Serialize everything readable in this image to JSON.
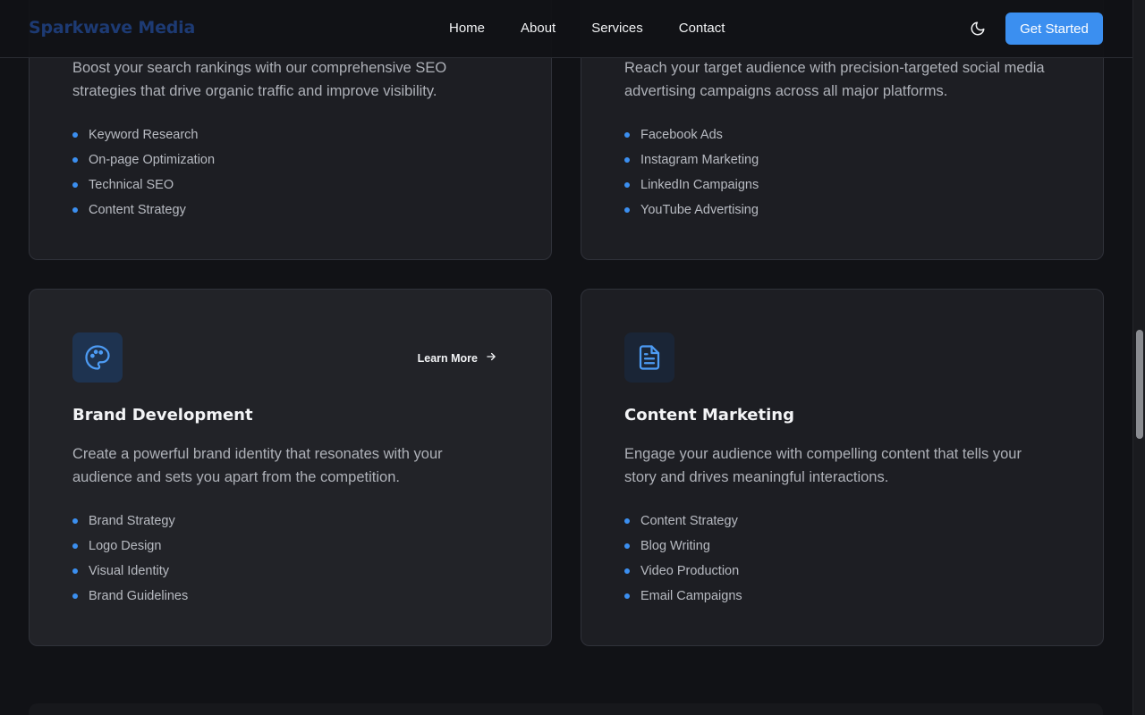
{
  "header": {
    "brand": "Sparkwave Media",
    "nav": [
      "Home",
      "About",
      "Services",
      "Contact"
    ],
    "cta": "Get Started",
    "theme_icon": "moon-icon"
  },
  "colors": {
    "accent": "#3b8ff0",
    "background": "#111216",
    "card": "#1d1e23"
  },
  "cards": [
    {
      "title": "",
      "description": "Boost your search rankings with our comprehensive SEO strategies that drive organic traffic and improve visibility.",
      "features": [
        "Keyword Research",
        "On-page Optimization",
        "Technical SEO",
        "Content Strategy"
      ]
    },
    {
      "title": "",
      "description": "Reach your target audience with precision-targeted social media advertising campaigns across all major platforms.",
      "features": [
        "Facebook Ads",
        "Instagram Marketing",
        "LinkedIn Campaigns",
        "YouTube Advertising"
      ]
    },
    {
      "title": "Brand Development",
      "icon": "palette-icon",
      "learn_more": "Learn More",
      "description": "Create a powerful brand identity that resonates with your audience and sets you apart from the competition.",
      "features": [
        "Brand Strategy",
        "Logo Design",
        "Visual Identity",
        "Brand Guidelines"
      ]
    },
    {
      "title": "Content Marketing",
      "icon": "document-icon",
      "description": "Engage your audience with compelling content that tells your story and drives meaningful interactions.",
      "features": [
        "Content Strategy",
        "Blog Writing",
        "Video Production",
        "Email Campaigns"
      ]
    }
  ]
}
